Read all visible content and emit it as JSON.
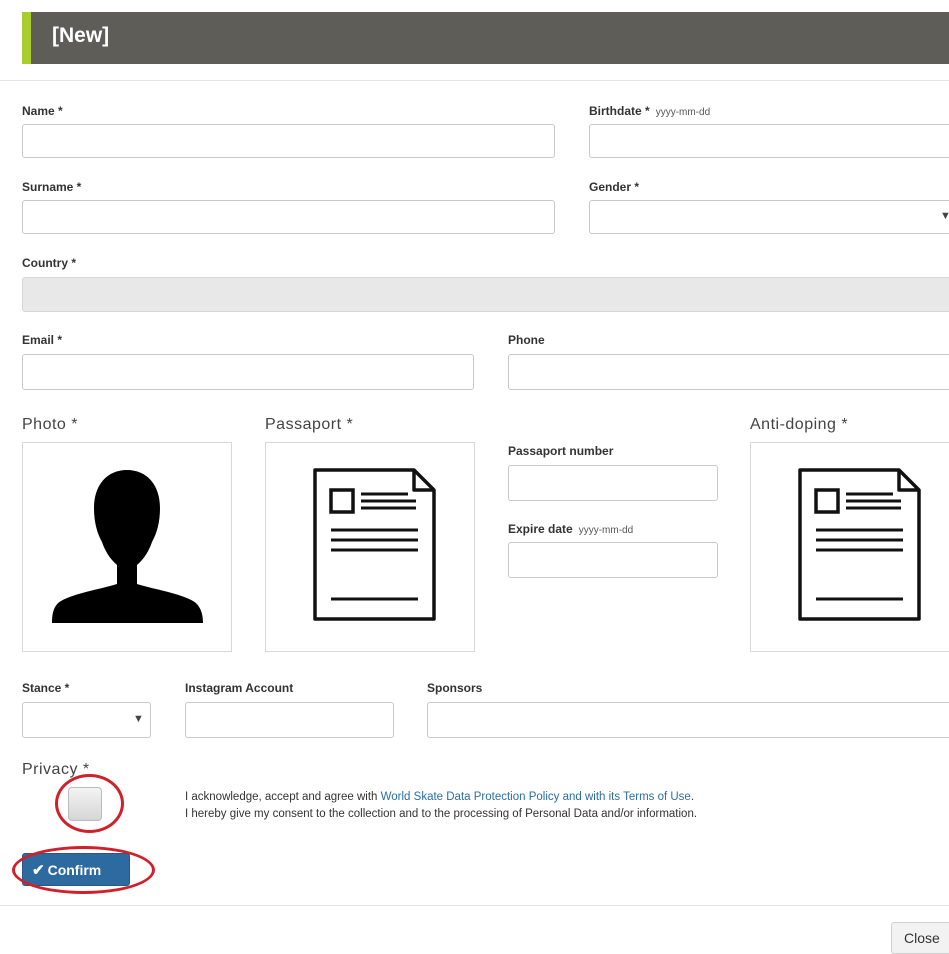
{
  "header": {
    "title": "[New]"
  },
  "fields": {
    "name": {
      "label": "Name *",
      "value": ""
    },
    "birthdate": {
      "label": "Birthdate *",
      "hint": "yyyy-mm-dd",
      "value": ""
    },
    "surname": {
      "label": "Surname *",
      "value": ""
    },
    "gender": {
      "label": "Gender *",
      "value": ""
    },
    "country": {
      "label": "Country *",
      "value": ""
    },
    "email": {
      "label": "Email *",
      "value": ""
    },
    "phone": {
      "label": "Phone",
      "value": ""
    },
    "passaport_number": {
      "label": "Passaport number",
      "value": ""
    },
    "expire_date": {
      "label": "Expire date",
      "hint": "yyyy-mm-dd",
      "value": ""
    },
    "stance": {
      "label": "Stance *",
      "value": ""
    },
    "instagram": {
      "label": "Instagram Account",
      "value": ""
    },
    "sponsors": {
      "label": "Sponsors",
      "value": ""
    }
  },
  "uploads": {
    "photo": {
      "label": "Photo *",
      "icon": "person-silhouette-icon"
    },
    "passaport": {
      "label": "Passaport *",
      "icon": "document-icon"
    },
    "antidoping": {
      "label": "Anti-doping *",
      "icon": "document-icon"
    }
  },
  "privacy": {
    "label": "Privacy *",
    "checked": false,
    "line1_prefix": "I acknowledge, accept and agree with ",
    "line1_link": "World Skate Data Protection Policy and with its Terms of Use",
    "line1_suffix": ".",
    "line2": "I hereby give my consent to the collection and to the processing of Personal Data and/or information."
  },
  "buttons": {
    "confirm": "Confirm",
    "close": "Close"
  },
  "colors": {
    "header_bg": "#5e5d58",
    "header_accent": "#a9cd2e",
    "primary": "#2d6a9f",
    "link": "#2b6ea3",
    "annotation": "#d0202a"
  }
}
